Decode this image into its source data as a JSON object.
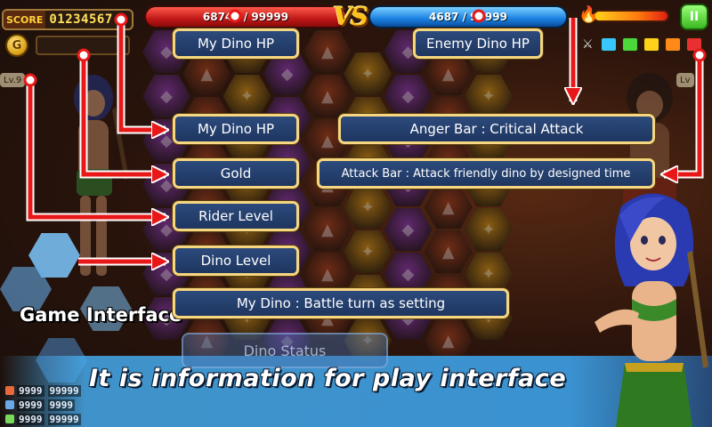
{
  "hud": {
    "score_label": "SCORE",
    "score_value": "01234567",
    "gold_icon_symbol": "G",
    "my_hp_text": "68743 / 99999",
    "enemy_hp_text": "4687 / 99999",
    "vs_text": "VS",
    "flame_symbol": "🔥",
    "sword_symbol": "⚔",
    "pause_symbol": "II",
    "attack_colors": [
      "#38c8ff",
      "#4ad83a",
      "#ffd21a",
      "#ff8a1a",
      "#e83030"
    ]
  },
  "level": {
    "left": "Lv.9",
    "right": "Lv"
  },
  "callouts": {
    "my_dino_hp_top": "My Dino HP",
    "enemy_dino_hp": "Enemy Dino HP",
    "my_dino_hp": "My Dino HP",
    "anger_bar": "Anger Bar : Critical Attack",
    "gold": "Gold",
    "attack_bar": "Attack Bar : Attack friendly dino by designed time",
    "rider_level": "Rider Level",
    "dino_level": "Dino Level",
    "my_dino": "My Dino : Battle turn as setting"
  },
  "bottom": {
    "dino_status": "Dino Status",
    "game_interface_title": "Game Interface",
    "banner_text": "It is information for play interface",
    "mini_stats": [
      "9999",
      "9999",
      "9999"
    ],
    "mini_stats_right": [
      "99999",
      "9999",
      "99999"
    ]
  },
  "board": {
    "tile_palette": [
      "#8a3aa8",
      "#3a9a3a",
      "#c88a1a",
      "#2a5aa8",
      "#a04020",
      "#5a3a8a"
    ],
    "tile_icons": [
      "◆",
      "❦",
      "✦",
      "●",
      "▲",
      "◈"
    ]
  },
  "colors": {
    "callout_border": "#f6d680",
    "arrow": "#e81818"
  }
}
